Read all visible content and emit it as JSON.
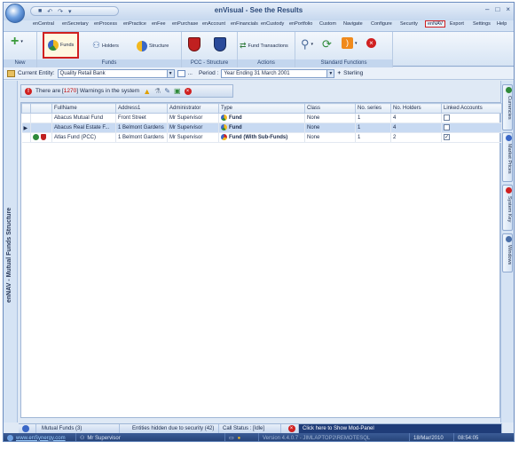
{
  "window": {
    "title": "enVisual - See the Results",
    "controls": [
      "–",
      "□",
      "×"
    ]
  },
  "menu": [
    "enCentral",
    "enSecretary",
    "enProcess",
    "enPractice",
    "enFee",
    "enPurchase",
    "enAccount",
    "enFinancials",
    "enCustody",
    "enPortfolio",
    "Custom",
    "Navigate",
    "Configure",
    "Security",
    "enNAV",
    "Export",
    "Settings",
    "Help"
  ],
  "ribbon": {
    "groups": {
      "new": "New",
      "funds": "Funds",
      "pcc": "PCC - Structure",
      "actions": "Actions",
      "standard": "Standard Functions"
    },
    "buttons": {
      "funds": "Funds",
      "holders": "Holders",
      "structure": "Structure",
      "fund_transactions": "Fund Transactions"
    }
  },
  "entity_bar": {
    "current_entity_label": "Current Entity:",
    "current_entity_value": "Quality Retail Bank",
    "period_label": "Period :",
    "period_value": "Year Ending 31 March 2001",
    "currency": "Sterling"
  },
  "side_label": "enNAV - Mutual Funds Structure",
  "right_tabs": [
    "Currencies",
    "Market Prices",
    "System Key",
    "Windows"
  ],
  "warning": {
    "prefix": "There are [",
    "count": "1270",
    "suffix": "] Warnings in the system"
  },
  "grid": {
    "columns": [
      "FullName",
      "Address1",
      "Administrator",
      "Type",
      "Class",
      "No. series",
      "No. Holders",
      "Linked Accounts"
    ],
    "rows": [
      {
        "full_name": "Abacus Mutual Fund",
        "address": "Front Street",
        "admin": "Mr Supervisor",
        "type": "Fund",
        "class": "None",
        "series": "1",
        "holders": "4",
        "linked": false
      },
      {
        "full_name": "Abacus Real Estate F...",
        "address": "1 Belmont Gardens",
        "admin": "Mr Supervisor",
        "type": "Fund",
        "class": "None",
        "series": "1",
        "holders": "4",
        "linked": false
      },
      {
        "full_name": "Atlas Fund (PCC)",
        "address": "1 Belmont Gardens",
        "admin": "Mr Supervisor",
        "type": "Fund (With Sub-Funds)",
        "class": "None",
        "series": "1",
        "holders": "2",
        "linked": true
      }
    ]
  },
  "status": {
    "mutual_funds": "Mutual Funds (3)",
    "hidden": "Entities hidden due to security (42)",
    "call_status": "Call Status : [Idle]",
    "mod_panel": "Click here to Show Mod-Panel"
  },
  "bottom": {
    "website": "www.enSynergy.com",
    "user": "Mr Supervisor",
    "version": "Version 4.4.0.7 - JIMLAPTOP2\\REMOTESQL",
    "date": "18/Mar/2010",
    "time": "08:54:05"
  },
  "colors": {
    "accent_red": "#d02020",
    "navy": "#213e73",
    "ribbon_blue": "#c3d6ee"
  }
}
